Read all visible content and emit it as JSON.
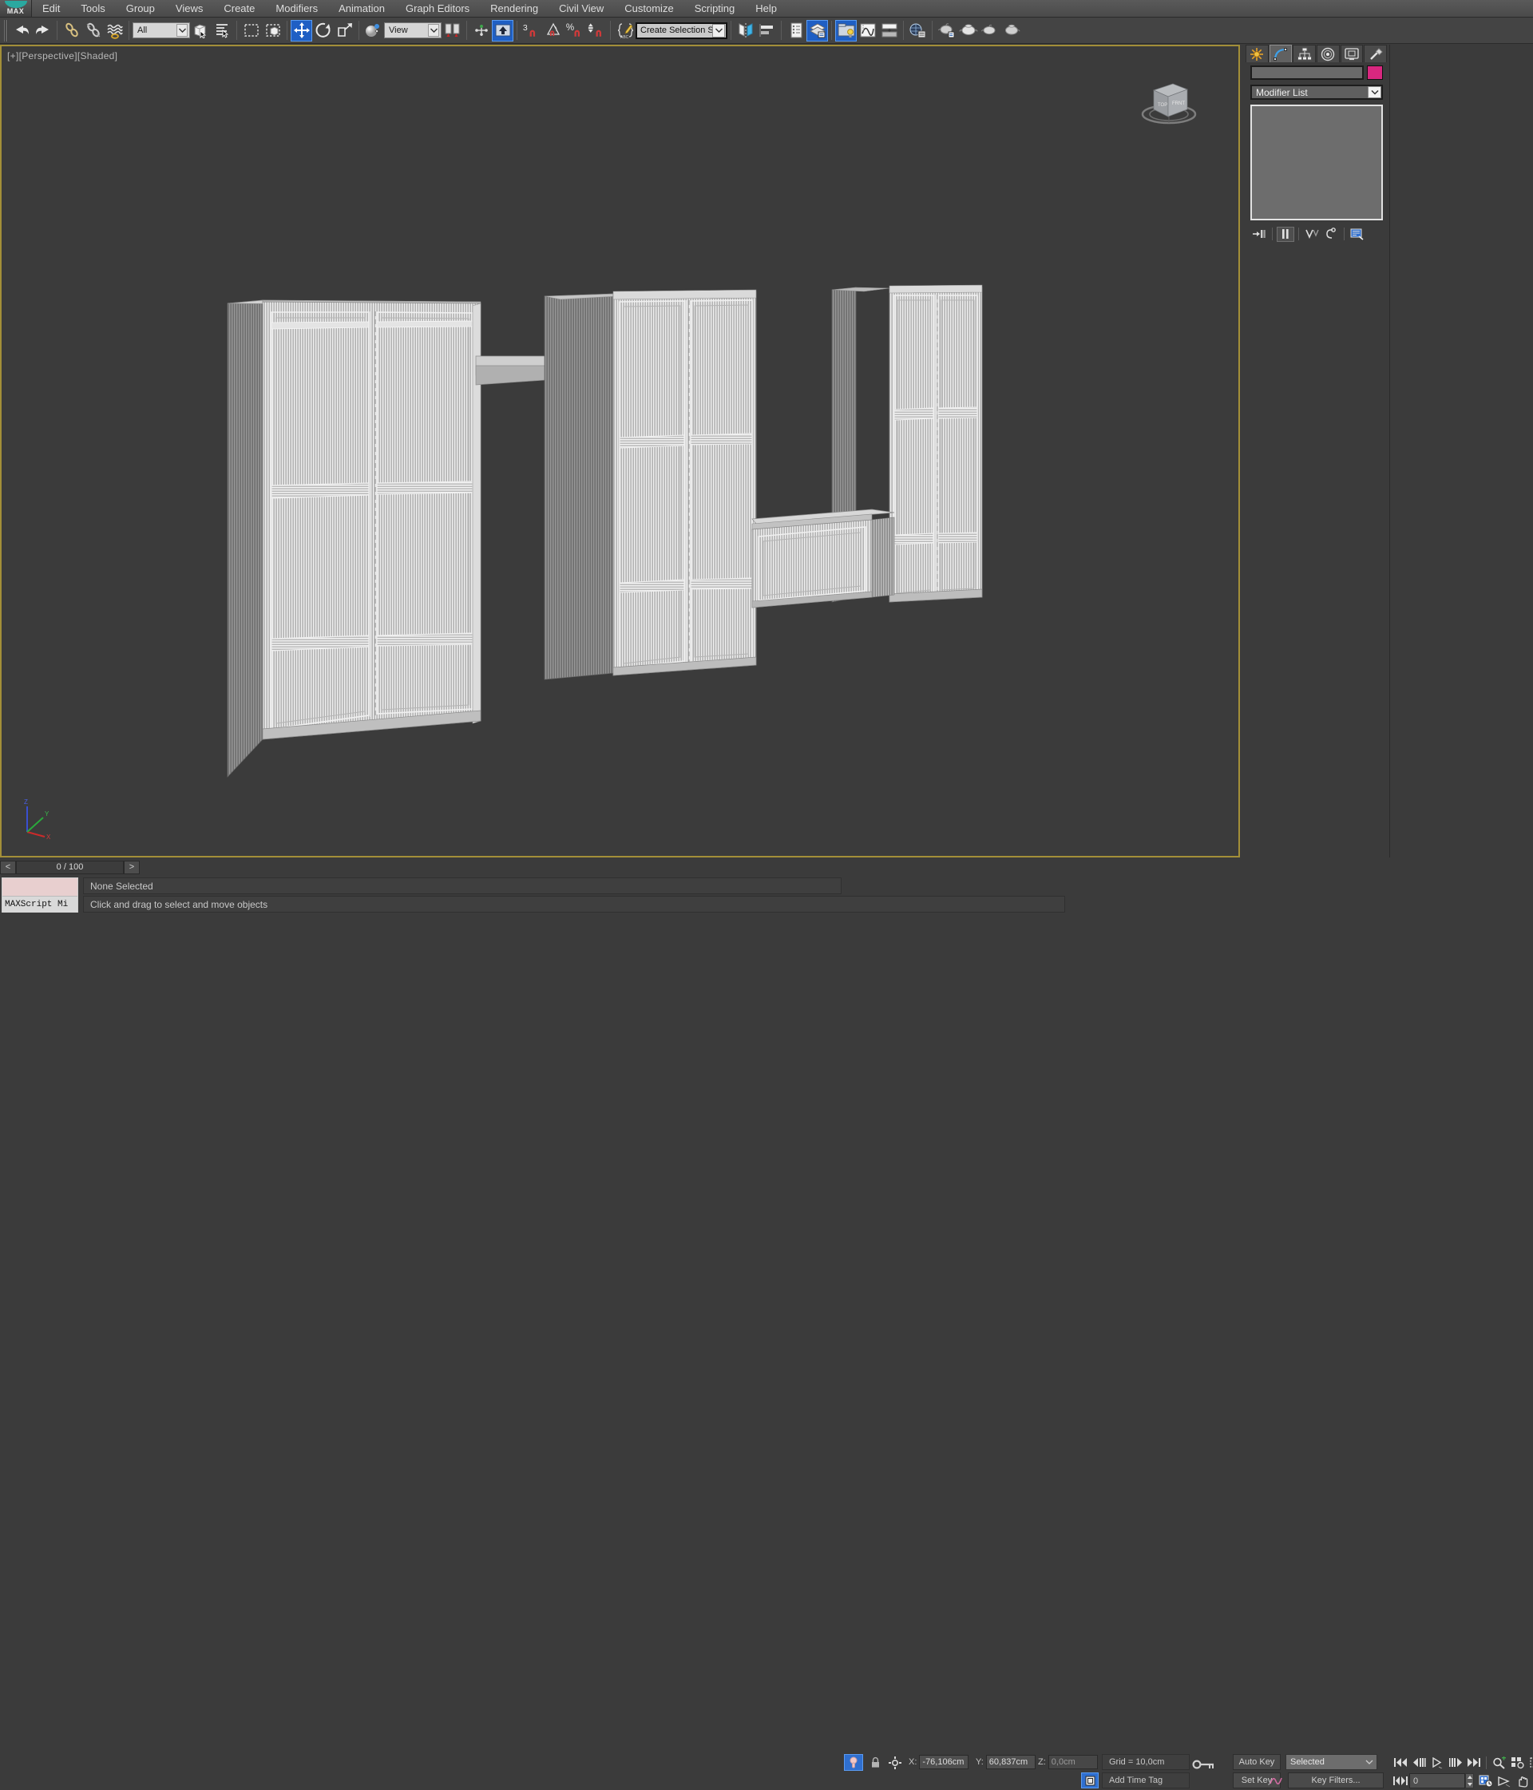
{
  "app": {
    "logo_text": "MAX",
    "accent": "#2aa9a0"
  },
  "menubar": {
    "items": [
      "Edit",
      "Tools",
      "Group",
      "Views",
      "Create",
      "Modifiers",
      "Animation",
      "Graph Editors",
      "Rendering",
      "Civil View",
      "Customize",
      "Scripting",
      "Help"
    ]
  },
  "toolbar": {
    "undo": "Undo",
    "redo": "Redo",
    "select_filter_value": "All",
    "reference_coord_value": "View",
    "selection_set_placeholder": "Create Selection Se",
    "selection_set_value": "Create Selection Se",
    "snap_percent_label": "%",
    "snap_three_label": "3",
    "buttons": [
      "undo-icon",
      "redo-icon",
      "select-link-icon",
      "unlink-icon",
      "bind-space-warp-icon",
      "select-object-icon",
      "select-by-name-icon",
      "rectangular-region-icon",
      "window-crossing-icon",
      "select-move-icon",
      "select-rotate-icon",
      "select-scale-icon",
      "use-center-icon",
      "mirror-icon",
      "align-icon",
      "layer-manager-icon",
      "graph-editor-icon",
      "curve-editor-icon",
      "schematic-view-icon",
      "material-editor-icon",
      "render-setup-icon",
      "rendered-frame-icon",
      "render-production-icon"
    ]
  },
  "viewport": {
    "label": "[+][Perspective][Shaded]",
    "border_color": "#a38f38",
    "background": "#3b3b3b",
    "viewcube_name": "view-cube",
    "axis_labels": {
      "x": "X",
      "y": "Y",
      "z": "Z"
    }
  },
  "command_panel": {
    "tabs": [
      "create-tab",
      "modify-tab",
      "hierarchy-tab",
      "motion-tab",
      "display-tab",
      "utilities-tab"
    ],
    "selected_tab": "modify-tab",
    "object_name": "",
    "object_color": "#d8277f",
    "modifier_list_label": "Modifier List",
    "stack_buttons": [
      "pin-stack-icon",
      "show-end-result-icon",
      "make-unique-icon",
      "remove-modifier-icon",
      "configure-sets-icon"
    ]
  },
  "timeslider": {
    "prev_label": "<",
    "next_label": ">",
    "frame_text": "0 / 100"
  },
  "statusbar": {
    "script_listener_label": "MAXScript Mi",
    "selection_status": "None Selected",
    "prompt": "Click and drag to select and move objects",
    "coords": {
      "x_label": "X:",
      "x_value": "-76,106cm",
      "y_label": "Y:",
      "y_value": "60,837cm",
      "z_label": "Z:",
      "z_value": "0,0cm"
    },
    "grid_info": "Grid = 10,0cm",
    "add_time_tag": "Add Time Tag",
    "lock_icon": "lock-selection-icon",
    "absolute_icon": "absolute-relative-mode-icon",
    "isolate_icon": "isolate-selection-icon"
  },
  "animation": {
    "auto_key": "Auto Key",
    "set_key": "Set Key",
    "filter_value": "Selected",
    "key_filters": "Key Filters...",
    "current_frame": "0",
    "nav_icons": [
      "go-to-start-icon",
      "previous-frame-icon",
      "play-animation-icon",
      "next-frame-icon",
      "go-to-end-icon"
    ],
    "view_icons": [
      "zoom-icon",
      "zoom-all-icon",
      "zoom-extents-icon",
      "zoom-extents-all-icon",
      "field-of-view-icon",
      "pan-view-icon",
      "orbit-icon",
      "maximize-viewport-icon"
    ],
    "key_mode_icon": "key-mode-toggle-icon",
    "time_config_icon": "time-configuration-icon"
  }
}
